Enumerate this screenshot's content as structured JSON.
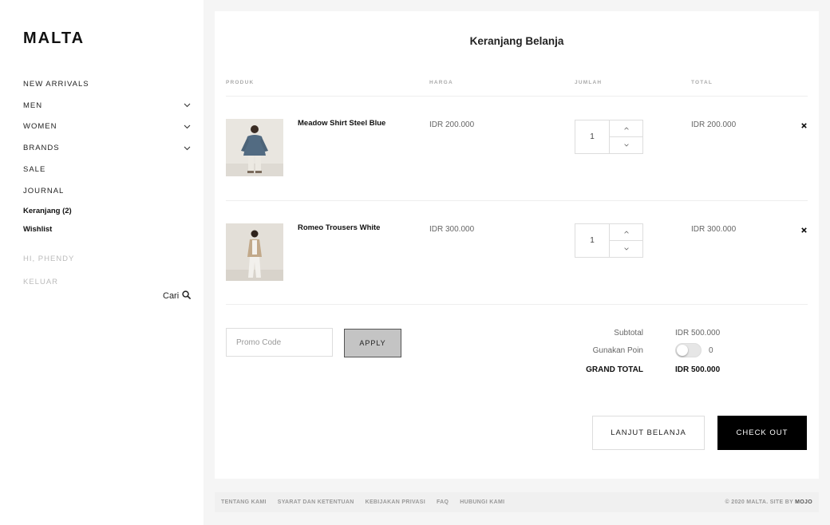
{
  "brand": "MALTA",
  "nav": {
    "items": [
      {
        "label": "NEW ARRIVALS",
        "has_children": false
      },
      {
        "label": "MEN",
        "has_children": true
      },
      {
        "label": "WOMEN",
        "has_children": true
      },
      {
        "label": "BRANDS",
        "has_children": true
      },
      {
        "label": "SALE",
        "has_children": false
      },
      {
        "label": "JOURNAL",
        "has_children": false
      }
    ],
    "cart": "Keranjang (2)",
    "wishlist": "Wishlist",
    "greeting": "HI, PHENDY",
    "logout": "KELUAR",
    "search": "Cari"
  },
  "cart": {
    "title": "Keranjang Belanja",
    "columns": {
      "product": "PRODUK",
      "price": "HARGA",
      "qty": "JUMLAH",
      "total": "TOTAL"
    },
    "items": [
      {
        "name": "Meadow Shirt Steel Blue",
        "price": "IDR 200.000",
        "qty": "1",
        "total": "IDR 200.000"
      },
      {
        "name": "Romeo Trousers White",
        "price": "IDR 300.000",
        "qty": "1",
        "total": "IDR 300.000"
      }
    ],
    "promo_placeholder": "Promo Code",
    "apply": "APPLY",
    "subtotal_label": "Subtotal",
    "subtotal": "IDR 500.000",
    "points_label": "Gunakan Poin",
    "points": "0",
    "grand_total_label": "GRAND TOTAL",
    "grand_total": "IDR 500.000",
    "continue": "LANJUT BELANJA",
    "checkout": "CHECK OUT"
  },
  "footer": {
    "links": [
      "TENTANG KAMI",
      "SYARAT DAN KETENTUAN",
      "KEBIJAKAN PRIVASI",
      "FAQ",
      "HUBUNGI KAMI"
    ],
    "copyright": "© 2020 MALTA. SITE BY",
    "credit": "MOJO"
  },
  "colors": {
    "accent": "#000000",
    "muted": "#aaaaaa",
    "background": "#f5f5f5"
  }
}
